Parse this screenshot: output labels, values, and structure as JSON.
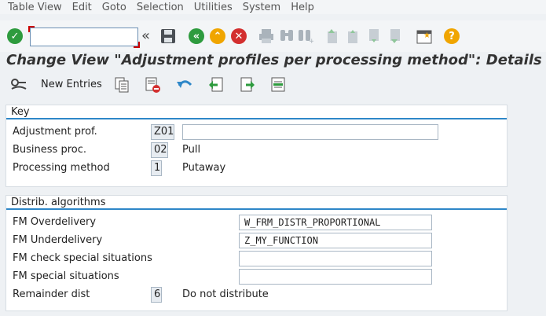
{
  "menu": [
    "Table View",
    "Edit",
    "Goto",
    "Selection",
    "Utilities",
    "System",
    "Help"
  ],
  "colors": {
    "green": "#2e9b3e",
    "orange": "#f0a500",
    "red": "#d32f2f",
    "blue": "#2e87c8"
  },
  "title": "Change View \"Adjustment profiles per processing method\": Details",
  "apptoolbar": {
    "new_entries": "New Entries"
  },
  "key_section": {
    "header": "Key",
    "adjustment_label": "Adjustment prof.",
    "adjustment_value": "Z01",
    "adjustment_desc": "",
    "business_label": "Business proc.",
    "business_value": "02",
    "business_desc": "Pull",
    "processing_label": "Processing method",
    "processing_value": "1",
    "processing_desc": "Putaway"
  },
  "distrib_section": {
    "header": "Distrib. algorithms",
    "fm_over_label": "FM Overdelivery",
    "fm_over_value": "W_FRM_DISTR_PROPORTIONAL",
    "fm_under_label": "FM Underdelivery",
    "fm_under_value": "Z_MY_FUNCTION",
    "fm_check_label": "FM check special situations",
    "fm_check_value": "",
    "fm_special_label": "FM special situations",
    "fm_special_value": "",
    "remainder_label": "Remainder dist",
    "remainder_value": "6",
    "remainder_desc": "Do not distribute"
  }
}
